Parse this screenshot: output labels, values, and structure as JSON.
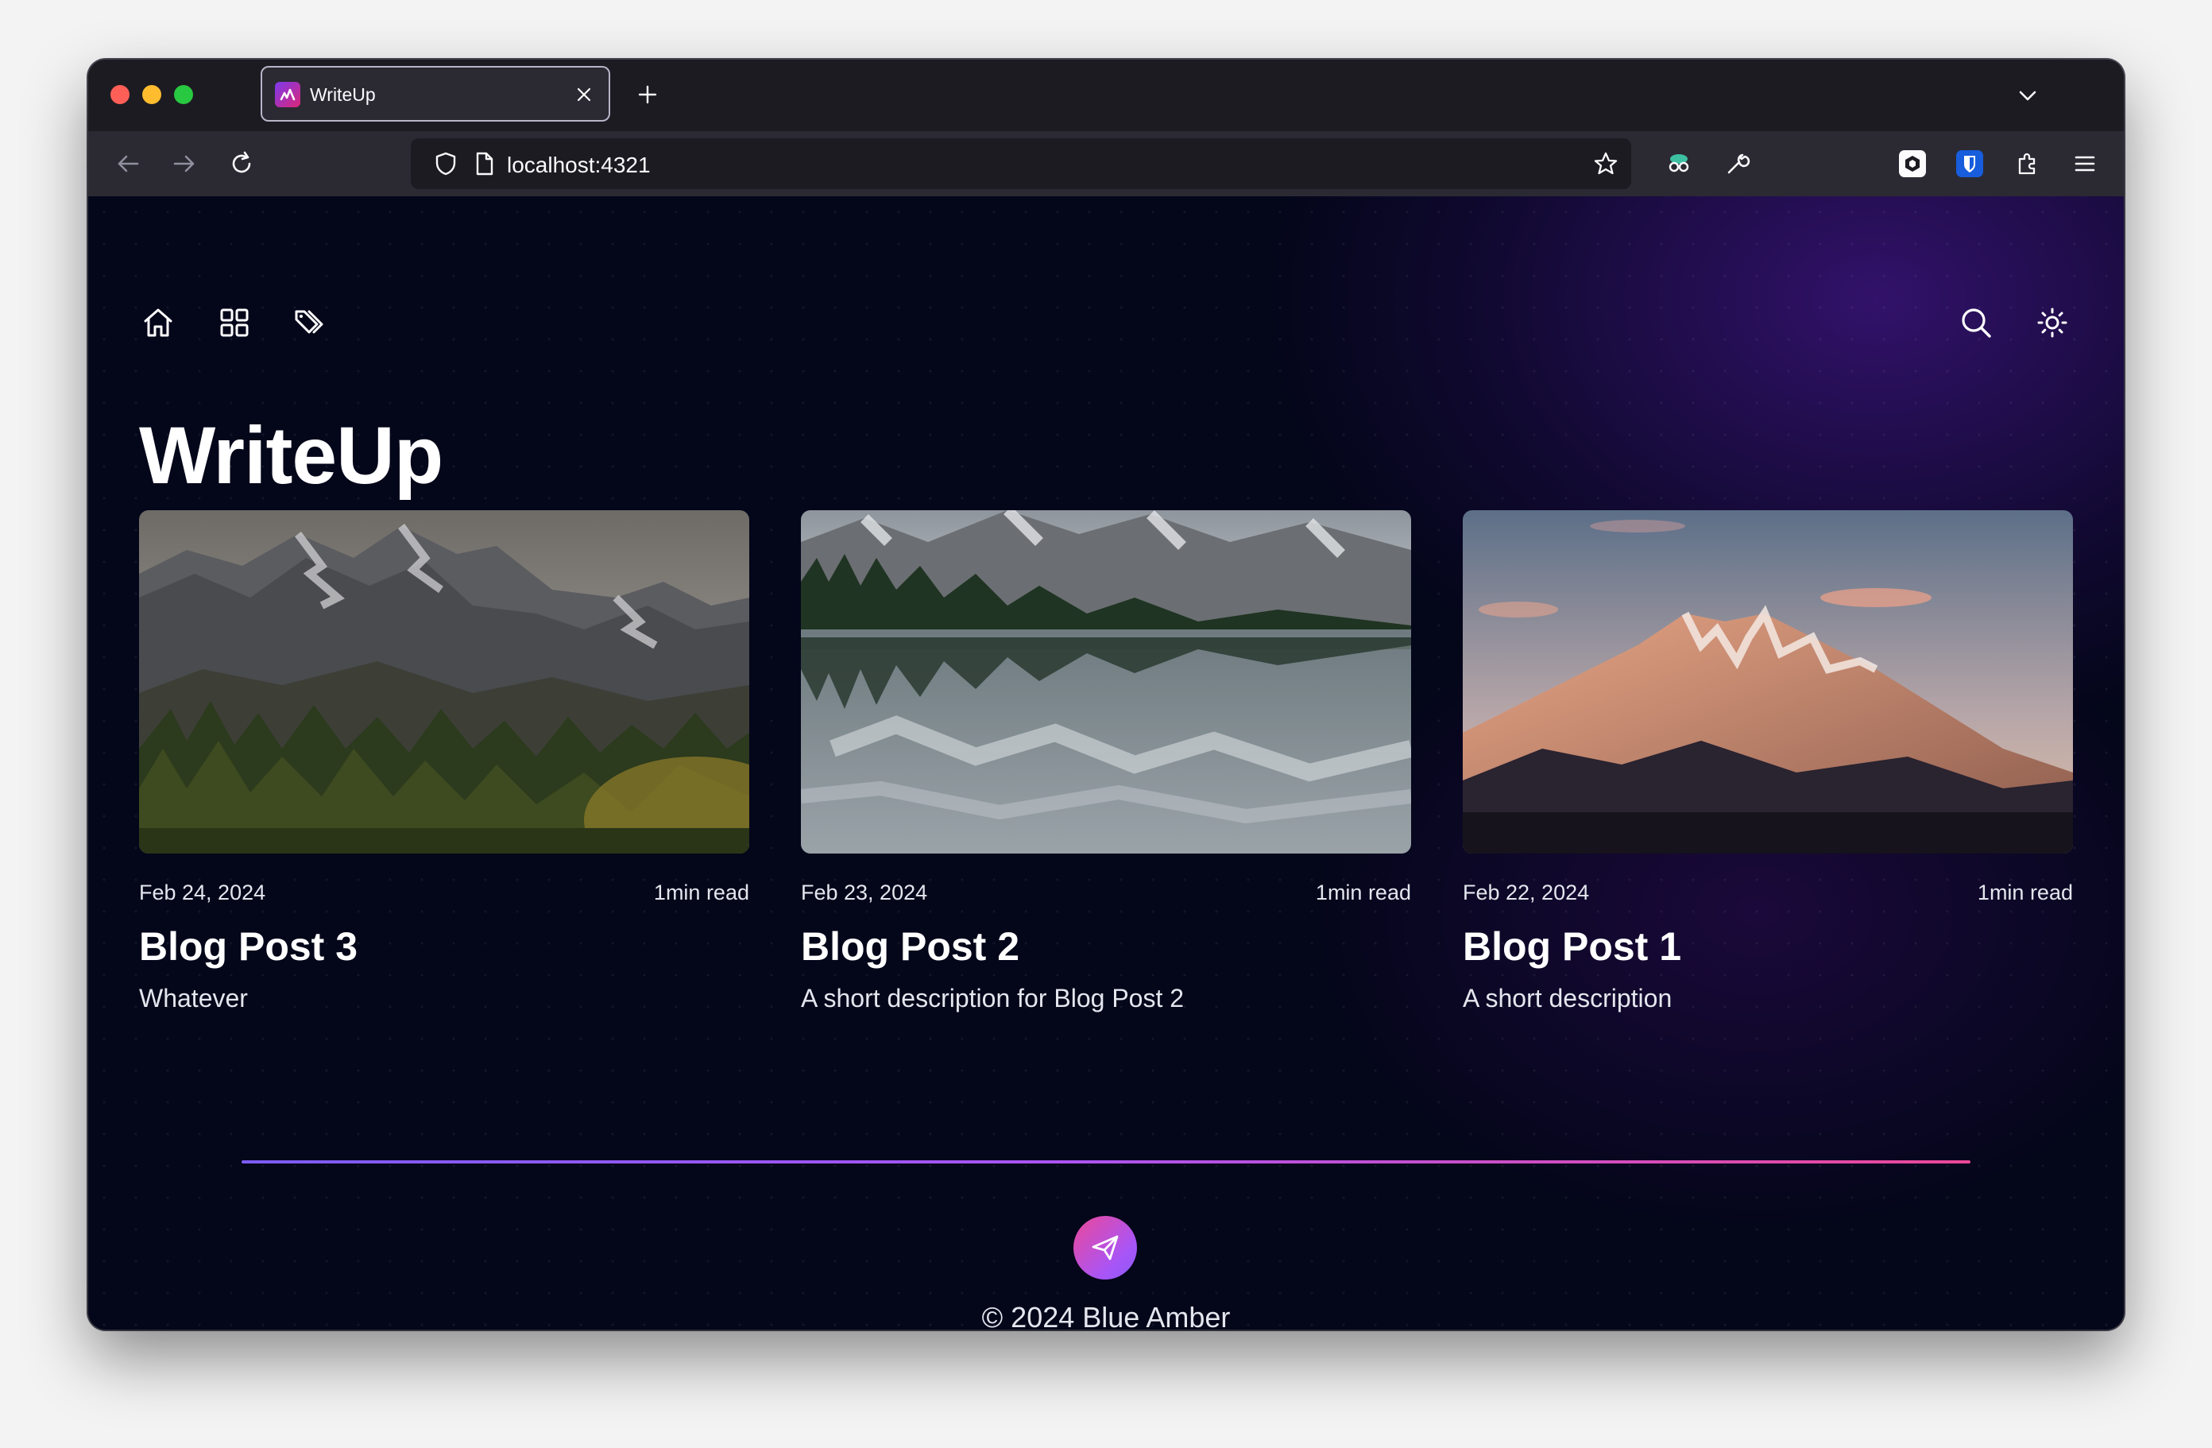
{
  "browser": {
    "tab_title": "WriteUp",
    "url": "localhost:4321"
  },
  "site": {
    "title": "WriteUp",
    "nav": [
      "home-icon",
      "grid-icon",
      "tags-icon"
    ],
    "actions": [
      "search-icon",
      "sun-icon"
    ]
  },
  "posts": [
    {
      "date": "Feb 24, 2024",
      "read_time": "1min read",
      "title": "Blog Post 3",
      "description": "Whatever",
      "image": "forested mountain range"
    },
    {
      "date": "Feb 23, 2024",
      "read_time": "1min read",
      "title": "Blog Post 2",
      "description": "A short description for Blog Post 2",
      "image": "mountain lake reflection"
    },
    {
      "date": "Feb 22, 2024",
      "read_time": "1min read",
      "title": "Blog Post 1",
      "description": "A short description",
      "image": "sunset mountain peak"
    }
  ],
  "footer": {
    "icon": "send-icon",
    "copyright": "© 2024 Blue Amber"
  },
  "colors": {
    "background": "#04061a",
    "accent_start": "#7c5cf6",
    "accent_end": "#ec4899"
  }
}
